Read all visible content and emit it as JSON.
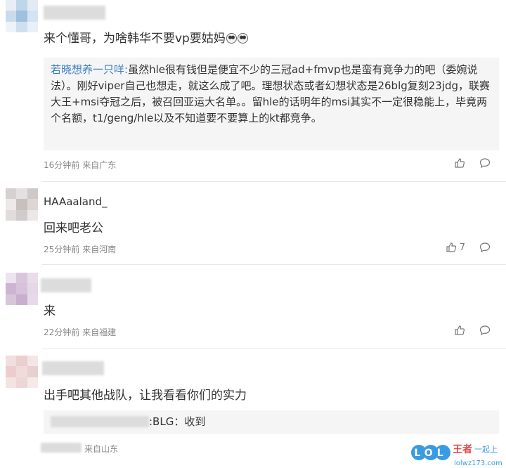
{
  "comments": [
    {
      "text": "来个懂哥，为啥韩华不要vp要姑妈",
      "quote": {
        "user": "若晓想养一只咩:",
        "body": "虽然hle很有钱但是便宜不少的三冠ad+fmvp也是蛮有竞争力的吧（委婉说法）。刚好viper自己也想走，就这么成了吧。理想状态或者幻想状态是26blg复刻23jdg，联赛大王+msi夺冠之后，被召回亚运大名单。。留hle的话明年的msi其实不一定很稳能上，毕竟两个名额，t1/geng/hle以及不知道要不要算上的kt都竞争。"
      },
      "time": "16分钟前",
      "location": "来自广东"
    },
    {
      "username": "HAAaaland_",
      "text": "回来吧老公",
      "time": "25分钟前",
      "location": "来自河南",
      "likes": "7"
    },
    {
      "text": "来",
      "time": "22分钟前",
      "location": "来自福建"
    },
    {
      "text": "出手吧其他战队，让我看看你们的实力",
      "reply": ":BLG：收到",
      "location": "来自山东"
    }
  ],
  "watermark": {
    "logo": "LOL",
    "brand": "王者",
    "slogan": "一起上",
    "url": "lolwz173.com"
  },
  "colors": {
    "link": "#3d7fc2",
    "meta": "#888888",
    "quote_bg": "#f5f5f5",
    "watermark_blue": "#3a9be0",
    "watermark_red": "#e04848"
  }
}
